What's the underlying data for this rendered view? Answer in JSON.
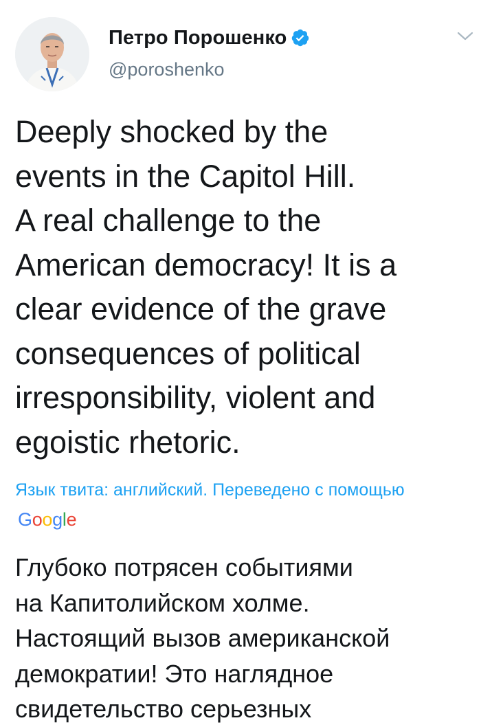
{
  "author": {
    "display_name": "Петро Порошенко",
    "handle": "@poroshenko",
    "verified": true
  },
  "tweet": {
    "text": "Deeply shocked by the\nevents in the Capitol Hill.\nA real challenge to the\nAmerican democracy! It is a\nclear evidence of the grave\nconsequences of political\nirresponsibility, violent and\negoistic rhetoric."
  },
  "translation_note": {
    "text": "Язык твита: английский. Переведено с помощью",
    "provider": "Google"
  },
  "translation": {
    "text": "Глубоко потрясен событиями\nна Капитолийском холме.\nНастоящий вызов американской\nдемократии! Это наглядное\nсвидетельство серьезных"
  },
  "colors": {
    "accent": "#1da1f2",
    "text": "#14171a",
    "secondary_text": "#657786",
    "google_blue": "#4285f4",
    "google_red": "#ea4335",
    "google_yellow": "#fbbc05",
    "google_green": "#34a853"
  },
  "icons": {
    "verified": "verified-badge-icon",
    "menu": "chevron-down-icon"
  }
}
